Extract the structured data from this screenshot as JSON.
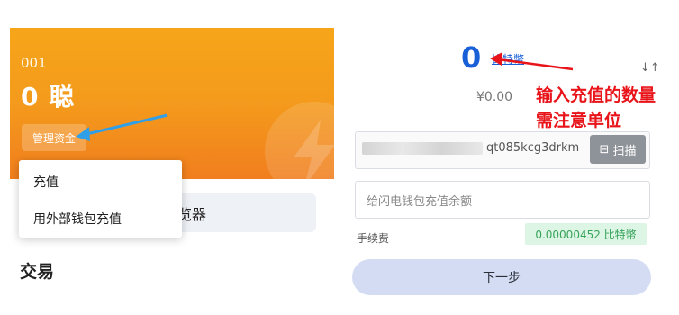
{
  "wallet_card": {
    "id": "001",
    "balance": "0 聪",
    "manage_label": "管理资金"
  },
  "dropdown": {
    "items": [
      {
        "label": "充值"
      },
      {
        "label": "用外部钱包充值"
      }
    ]
  },
  "browser_button": {
    "label": "览器"
  },
  "section": {
    "title": "交易"
  },
  "deposit": {
    "amount": "0",
    "unit": "比特幣",
    "fiat": "¥0.00",
    "address_suffix": "qt085kcg3drkm",
    "scan_label": "扫描",
    "memo_placeholder": "给闪电钱包充值余额",
    "fee_label": "手续费",
    "fee_value": "0.00000452 比特幣",
    "next_label": "下一步"
  },
  "annotation": {
    "text": "输入充值的数量需注意单位",
    "color": "#e8141a",
    "arrow_color_left": "#2f9fe8"
  },
  "colors": {
    "card_orange": "#f49a1c",
    "amount_blue": "#1960d8",
    "fee_green": "#37a35a",
    "next_button_bg": "#d3dcf2"
  }
}
